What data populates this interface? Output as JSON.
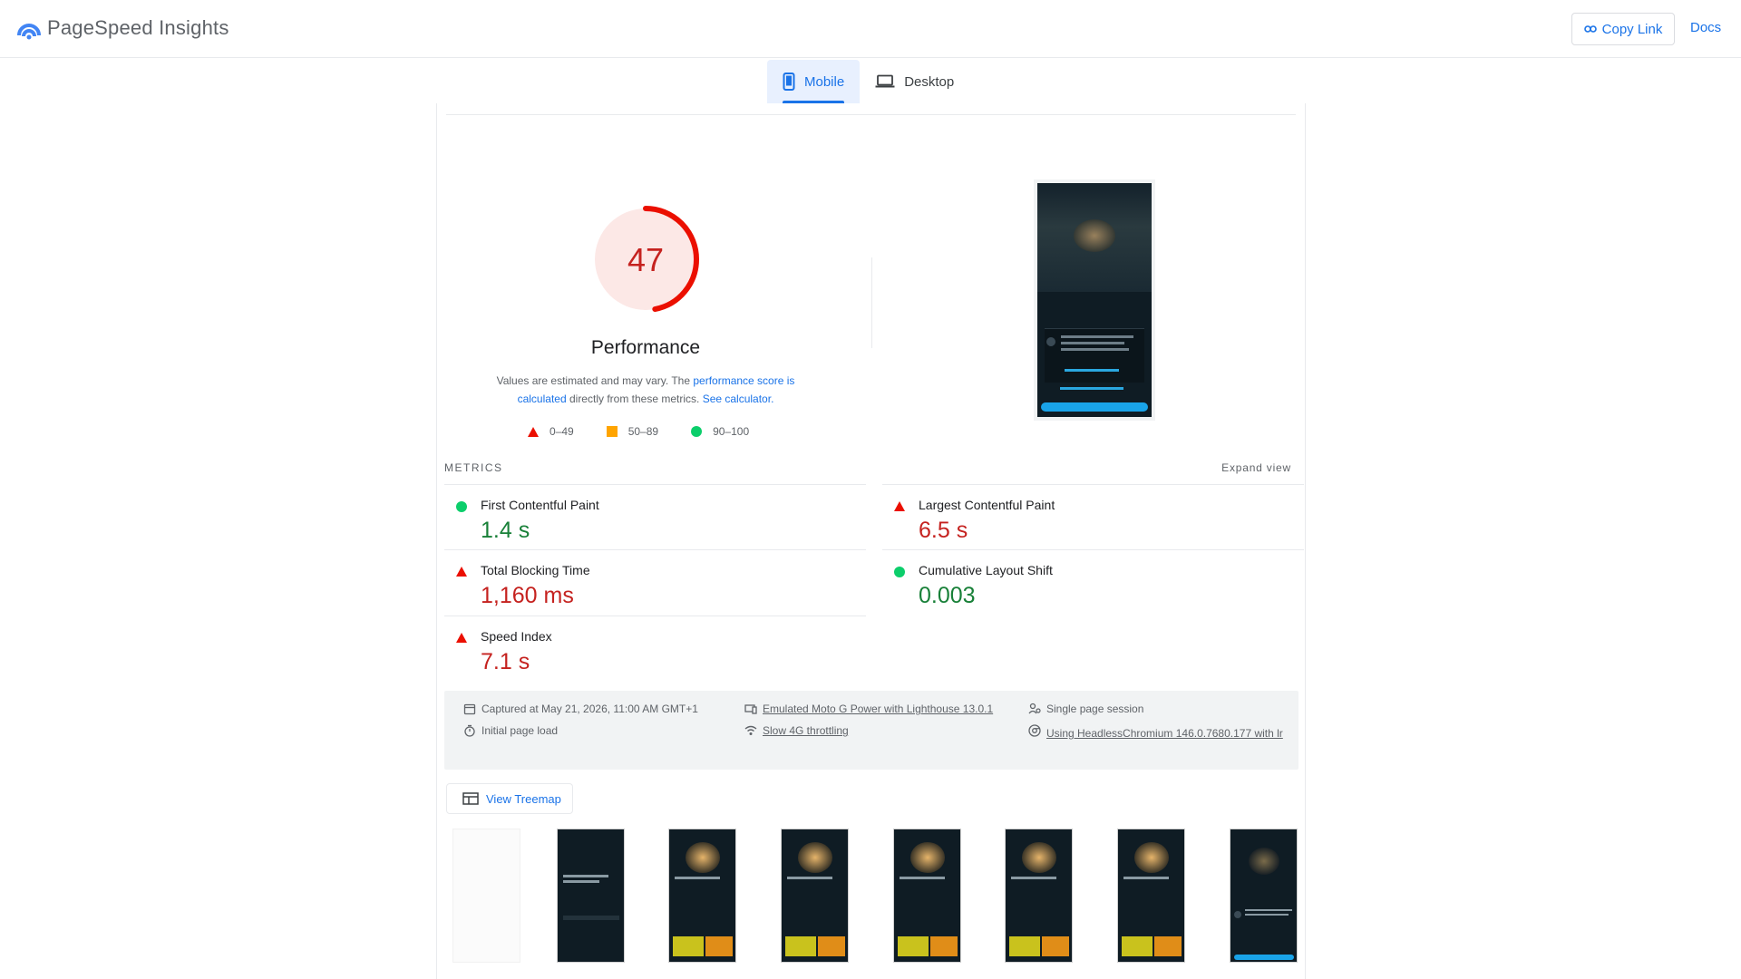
{
  "header": {
    "app_title": "PageSpeed Insights",
    "copy_link_label": "Copy Link",
    "docs_label": "Docs"
  },
  "tabs": [
    {
      "label": "Mobile",
      "active": true
    },
    {
      "label": "Desktop",
      "active": false
    }
  ],
  "performance": {
    "score": "47",
    "score_fraction": 0.47,
    "title": "Performance",
    "desc_prefix": "Values are estimated and may vary. The ",
    "desc_link1": "performance score is calculated",
    "desc_mid": " directly from these metrics. ",
    "desc_link2": "See calculator.",
    "legend": [
      {
        "range": "0–49",
        "shape": "triangle-red"
      },
      {
        "range": "50–89",
        "shape": "square-orange"
      },
      {
        "range": "90–100",
        "shape": "circle-green"
      }
    ]
  },
  "metrics": {
    "section_label": "METRICS",
    "expand_label": "Expand view",
    "items": [
      {
        "title": "First Contentful Paint",
        "value": "1.4 s",
        "status": "good"
      },
      {
        "title": "Largest Contentful Paint",
        "value": "6.5 s",
        "status": "poor"
      },
      {
        "title": "Total Blocking Time",
        "value": "1,160 ms",
        "status": "poor"
      },
      {
        "title": "Cumulative Layout Shift",
        "value": "0.003",
        "status": "good"
      },
      {
        "title": "Speed Index",
        "value": "7.1 s",
        "status": "poor"
      }
    ]
  },
  "info": {
    "captured": "Captured at May 21, 2026, 11:00 AM GMT+1",
    "load": "Initial page load",
    "device": "Emulated Moto G Power with Lighthouse 13.0.1",
    "throttling": "Slow 4G throttling",
    "session": "Single page session",
    "browser": "Using HeadlessChromium 146.0.7680.177 with lr"
  },
  "treemap_label": "View Treemap",
  "colors": {
    "accent": "#1a73e8",
    "poor": "#eb0f00",
    "average": "#ffa400",
    "good": "#0cce6b"
  }
}
